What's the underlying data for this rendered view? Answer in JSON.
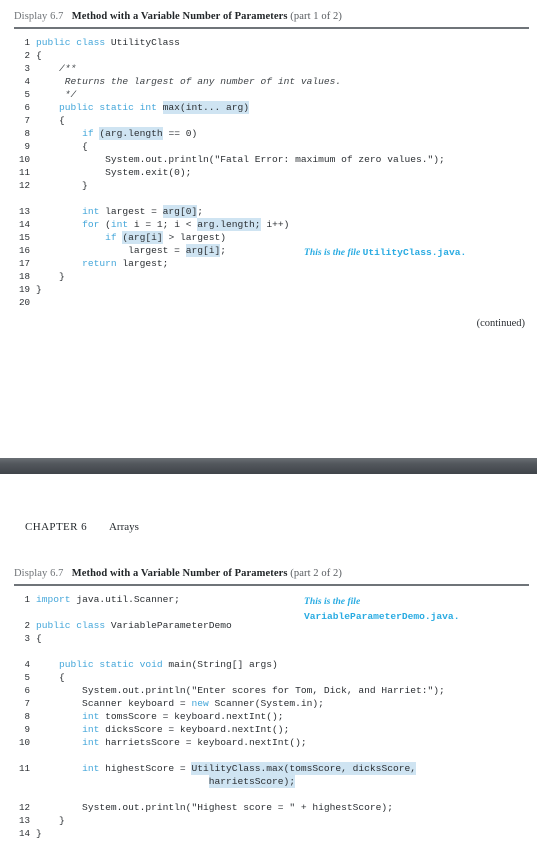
{
  "theme": {
    "keyword_color": "#45a7da",
    "highlight_color": "#cfe4f2",
    "annotation_color": "#29abe2",
    "rule_color": "#6f7479",
    "band_color": "#4a4f54",
    "text_color": "#2b2f33"
  },
  "part1": {
    "caption": {
      "label": "Display 6.7",
      "title": "Method with a Variable Number of Parameters",
      "part": "(part 1 of 2)"
    },
    "lines": [
      {
        "n": "1",
        "segments": [
          {
            "t": "public class ",
            "s": "kw"
          },
          {
            "t": "UtilityClass",
            "s": ""
          }
        ]
      },
      {
        "n": "2",
        "segments": [
          {
            "t": "{",
            "s": ""
          }
        ]
      },
      {
        "n": "3",
        "segments": [
          {
            "t": "    ",
            "s": ""
          },
          {
            "t": "/**",
            "s": "cmt"
          }
        ]
      },
      {
        "n": "4",
        "segments": [
          {
            "t": "     ",
            "s": ""
          },
          {
            "t": "Returns the largest of any number of int values.",
            "s": "cmt"
          }
        ]
      },
      {
        "n": "5",
        "segments": [
          {
            "t": "     ",
            "s": ""
          },
          {
            "t": "*/",
            "s": "cmt"
          }
        ]
      },
      {
        "n": "6",
        "segments": [
          {
            "t": "    ",
            "s": ""
          },
          {
            "t": "public static int ",
            "s": "kw"
          },
          {
            "t": "max(int... arg)",
            "s": "hl"
          }
        ]
      },
      {
        "n": "7",
        "segments": [
          {
            "t": "    {",
            "s": ""
          }
        ]
      },
      {
        "n": "8",
        "segments": [
          {
            "t": "        ",
            "s": ""
          },
          {
            "t": "if ",
            "s": "kw"
          },
          {
            "t": "(arg.length",
            "s": "hl"
          },
          {
            "t": " == 0)",
            "s": ""
          }
        ]
      },
      {
        "n": "9",
        "segments": [
          {
            "t": "        {",
            "s": ""
          }
        ]
      },
      {
        "n": "10",
        "segments": [
          {
            "t": "            System.out.println(\"Fatal Error: maximum of zero values.\");",
            "s": ""
          }
        ]
      },
      {
        "n": "11",
        "segments": [
          {
            "t": "            System.exit(0);",
            "s": ""
          }
        ]
      },
      {
        "n": "12",
        "segments": [
          {
            "t": "        }",
            "s": ""
          }
        ]
      },
      {
        "n": "",
        "segments": [
          {
            "t": "",
            "s": ""
          }
        ]
      },
      {
        "n": "13",
        "segments": [
          {
            "t": "        ",
            "s": ""
          },
          {
            "t": "int ",
            "s": "kw"
          },
          {
            "t": "largest = ",
            "s": ""
          },
          {
            "t": "arg[0]",
            "s": "hl"
          },
          {
            "t": ";",
            "s": ""
          }
        ]
      },
      {
        "n": "14",
        "segments": [
          {
            "t": "        ",
            "s": ""
          },
          {
            "t": "for ",
            "s": "kw"
          },
          {
            "t": "(",
            "s": ""
          },
          {
            "t": "int ",
            "s": "kw"
          },
          {
            "t": "i = 1; i < ",
            "s": ""
          },
          {
            "t": "arg.length;",
            "s": "hl"
          },
          {
            "t": " i++)",
            "s": ""
          }
        ]
      },
      {
        "n": "15",
        "segments": [
          {
            "t": "            ",
            "s": ""
          },
          {
            "t": "if ",
            "s": "kw"
          },
          {
            "t": "(arg[i]",
            "s": "hl"
          },
          {
            "t": " > largest)",
            "s": ""
          }
        ]
      },
      {
        "n": "16",
        "segments": [
          {
            "t": "                largest = ",
            "s": ""
          },
          {
            "t": "arg[i]",
            "s": "hl"
          },
          {
            "t": ";",
            "s": ""
          }
        ]
      },
      {
        "n": "17",
        "segments": [
          {
            "t": "        ",
            "s": ""
          },
          {
            "t": "return ",
            "s": "kw"
          },
          {
            "t": "largest;",
            "s": ""
          }
        ]
      },
      {
        "n": "18",
        "segments": [
          {
            "t": "    }",
            "s": ""
          }
        ]
      },
      {
        "n": "19",
        "segments": [
          {
            "t": "}",
            "s": ""
          }
        ]
      },
      {
        "n": "20",
        "segments": [
          {
            "t": "",
            "s": ""
          }
        ]
      }
    ],
    "annotation": {
      "text": "This is the file ",
      "code": "UtilityClass.java",
      "suffix": "."
    },
    "continued_label": "(continued)"
  },
  "running_head": {
    "chapter": "CHAPTER 6",
    "title": "Arrays"
  },
  "part2": {
    "caption": {
      "label": "Display 6.7",
      "title": "Method with a Variable Number of Parameters",
      "part": "(part 2 of 2)"
    },
    "lines": [
      {
        "n": "1",
        "segments": [
          {
            "t": "import ",
            "s": "kw"
          },
          {
            "t": "java.util.Scanner;",
            "s": ""
          }
        ]
      },
      {
        "n": "",
        "segments": [
          {
            "t": "",
            "s": ""
          }
        ]
      },
      {
        "n": "2",
        "segments": [
          {
            "t": "public class ",
            "s": "kw"
          },
          {
            "t": "VariableParameterDemo",
            "s": ""
          }
        ]
      },
      {
        "n": "3",
        "segments": [
          {
            "t": "{",
            "s": ""
          }
        ]
      },
      {
        "n": "",
        "segments": [
          {
            "t": "",
            "s": ""
          }
        ]
      },
      {
        "n": "4",
        "segments": [
          {
            "t": "    ",
            "s": ""
          },
          {
            "t": "public static void ",
            "s": "kw"
          },
          {
            "t": "main(String[] args)",
            "s": ""
          }
        ]
      },
      {
        "n": "5",
        "segments": [
          {
            "t": "    {",
            "s": ""
          }
        ]
      },
      {
        "n": "6",
        "segments": [
          {
            "t": "        System.out.println(\"Enter scores for Tom, Dick, and Harriet:\");",
            "s": ""
          }
        ]
      },
      {
        "n": "7",
        "segments": [
          {
            "t": "        Scanner keyboard = ",
            "s": ""
          },
          {
            "t": "new ",
            "s": "kw"
          },
          {
            "t": "Scanner(System.in);",
            "s": ""
          }
        ]
      },
      {
        "n": "8",
        "segments": [
          {
            "t": "        ",
            "s": ""
          },
          {
            "t": "int ",
            "s": "kw"
          },
          {
            "t": "tomsScore = keyboard.nextInt();",
            "s": ""
          }
        ]
      },
      {
        "n": "9",
        "segments": [
          {
            "t": "        ",
            "s": ""
          },
          {
            "t": "int ",
            "s": "kw"
          },
          {
            "t": "dicksScore = keyboard.nextInt();",
            "s": ""
          }
        ]
      },
      {
        "n": "10",
        "segments": [
          {
            "t": "        ",
            "s": ""
          },
          {
            "t": "int ",
            "s": "kw"
          },
          {
            "t": "harrietsScore = keyboard.nextInt();",
            "s": ""
          }
        ]
      },
      {
        "n": "",
        "segments": [
          {
            "t": "",
            "s": ""
          }
        ]
      },
      {
        "n": "11",
        "segments": [
          {
            "t": "        ",
            "s": ""
          },
          {
            "t": "int ",
            "s": "kw"
          },
          {
            "t": "highestScore = ",
            "s": ""
          },
          {
            "t": "UtilityClass.max(tomsScore, dicksScore,",
            "s": "hl"
          }
        ]
      },
      {
        "n": "",
        "segments": [
          {
            "t": "                              ",
            "s": ""
          },
          {
            "t": "harrietsScore);",
            "s": "hl"
          }
        ]
      },
      {
        "n": "",
        "segments": [
          {
            "t": "",
            "s": ""
          }
        ]
      },
      {
        "n": "12",
        "segments": [
          {
            "t": "        System.out.println(\"Highest score = \" + highestScore);",
            "s": ""
          }
        ]
      },
      {
        "n": "13",
        "segments": [
          {
            "t": "    }",
            "s": ""
          }
        ]
      },
      {
        "n": "14",
        "segments": [
          {
            "t": "}",
            "s": ""
          }
        ]
      }
    ],
    "annotation": {
      "line1": "This is the file",
      "code": "VariableParameterDemo.java",
      "suffix": "."
    }
  }
}
